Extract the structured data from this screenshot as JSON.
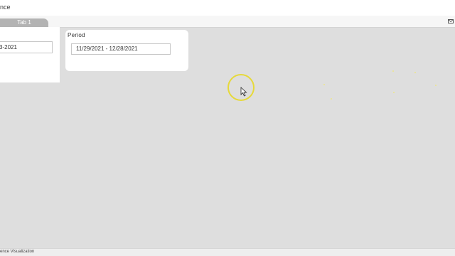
{
  "header": {
    "title": "nce"
  },
  "tabs": [
    {
      "label": "Tab 1"
    }
  ],
  "filters": {
    "left_date_value": "3-2021",
    "period": {
      "label": "Period",
      "value": "11/29/2021 - 12/28/2021"
    }
  },
  "footer": {
    "text": "ence Visualization"
  },
  "colors": {
    "canvas": "#dedede",
    "tab": "#b3b3b3",
    "cursor_highlight": "#e6d93a"
  },
  "icons": {
    "top_right": "mail-icon",
    "pointer": "mouse-cursor-icon"
  }
}
